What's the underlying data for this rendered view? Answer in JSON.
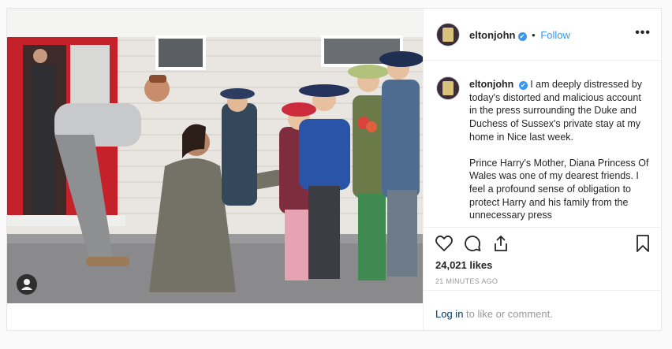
{
  "post": {
    "username": "eltonjohn",
    "verified_mark": "✔",
    "separator": "•",
    "follow_label": "Follow",
    "more_label": "•••",
    "caption_paragraph_1": "I am deeply distressed by today's distorted and malicious account in the press surrounding the Duke and Duchess of Sussex's private stay at my home in Nice last week.",
    "caption_paragraph_2": "Prince Harry's Mother, Diana Princess Of Wales was one of my dearest friends. I feel a profound sense of obligation to protect Harry and his family from the unnecessary press",
    "likes_count": "24,021",
    "likes_word": "likes",
    "timestamp": "21 MINUTES AGO",
    "login_link": "Log in",
    "login_rest": " to like or comment."
  },
  "icons": {
    "like": "heart-icon",
    "comment": "comment-icon",
    "share": "share-icon",
    "save": "bookmark-icon",
    "more": "more-options-icon",
    "tag": "user-tag-icon"
  },
  "colors": {
    "link_blue": "#3897f0",
    "text": "#262626",
    "muted": "#999999",
    "border": "#efefef"
  }
}
